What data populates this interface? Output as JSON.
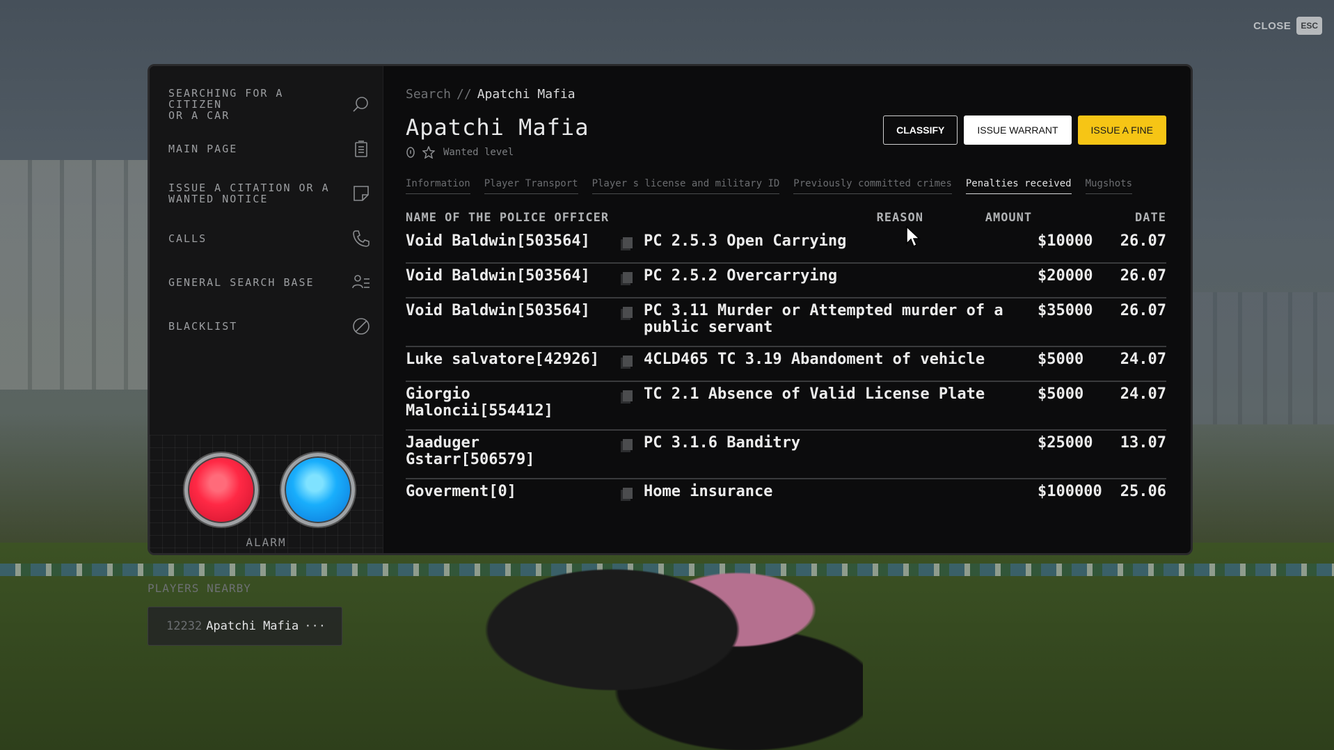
{
  "close": {
    "label": "CLOSE",
    "key": "ESC"
  },
  "sidebar": {
    "items": [
      {
        "label": "SEARCHING FOR A\nCITIZEN\nOR A CAR",
        "icon": "search-icon"
      },
      {
        "label": "MAIN PAGE",
        "icon": "clipboard-icon"
      },
      {
        "label": "ISSUE A CITATION OR A\nWANTED NOTICE",
        "icon": "note-icon"
      },
      {
        "label": "CALLS",
        "icon": "phone-icon"
      },
      {
        "label": "GENERAL SEARCH BASE",
        "icon": "people-list-icon"
      },
      {
        "label": "BLACKLIST",
        "icon": "ban-icon"
      }
    ],
    "alarm_label": "ALARM"
  },
  "breadcrumb": {
    "root": "Search",
    "separator": "//",
    "current": "Apatchi Mafia"
  },
  "profile": {
    "name": "Apatchi Mafia",
    "wanted_level_label": "Wanted level",
    "wanted_stars": 0
  },
  "actions": {
    "classify": "CLASSIFY",
    "issue_warrant": "ISSUE WARRANT",
    "issue_fine": "ISSUE A FINE"
  },
  "tabs": [
    {
      "label": "Information",
      "active": false
    },
    {
      "label": "Player Transport",
      "active": false
    },
    {
      "label": "Player s license and military ID",
      "active": false
    },
    {
      "label": "Previously committed crimes",
      "active": false
    },
    {
      "label": "Penalties received",
      "active": true
    },
    {
      "label": "Mugshots",
      "active": false
    }
  ],
  "table": {
    "headers": {
      "officer": "NAME OF THE POLICE OFFICER",
      "reason": "REASON",
      "amount": "AMOUNT",
      "date": "DATE"
    },
    "rows": [
      {
        "officer": "Void Baldwin[503564]",
        "reason": "PC 2.5.3 Open Carrying",
        "amount": "$10000",
        "date": "26.07"
      },
      {
        "officer": "Void Baldwin[503564]",
        "reason": "PC 2.5.2 Overcarrying",
        "amount": "$20000",
        "date": "26.07"
      },
      {
        "officer": "Void Baldwin[503564]",
        "reason": "PC 3.11 Murder or Attempted murder of a public servant",
        "amount": "$35000",
        "date": "26.07"
      },
      {
        "officer": "Luke salvatore[42926]",
        "reason": "4CLD465 TC 3.19 Abandoment of vehicle",
        "amount": "$5000",
        "date": "24.07"
      },
      {
        "officer": "Giorgio Maloncii[554412]",
        "reason": "TC 2.1 Absence of Valid License Plate",
        "amount": "$5000",
        "date": "24.07"
      },
      {
        "officer": "Jaaduger Gstarr[506579]",
        "reason": "PC 3.1.6 Banditry",
        "amount": "$25000",
        "date": "13.07"
      },
      {
        "officer": "Goverment[0]",
        "reason": "Home insurance",
        "amount": "$100000",
        "date": "25.06"
      }
    ]
  },
  "players_nearby": {
    "title": "PLAYERS NEARBY",
    "players": [
      {
        "id": "12232",
        "name": "Apatchi Mafia",
        "more": "···"
      }
    ]
  },
  "colors": {
    "accent_yellow": "#f6c515",
    "alarm_red": "#ff2945",
    "alarm_blue": "#19aefc"
  }
}
